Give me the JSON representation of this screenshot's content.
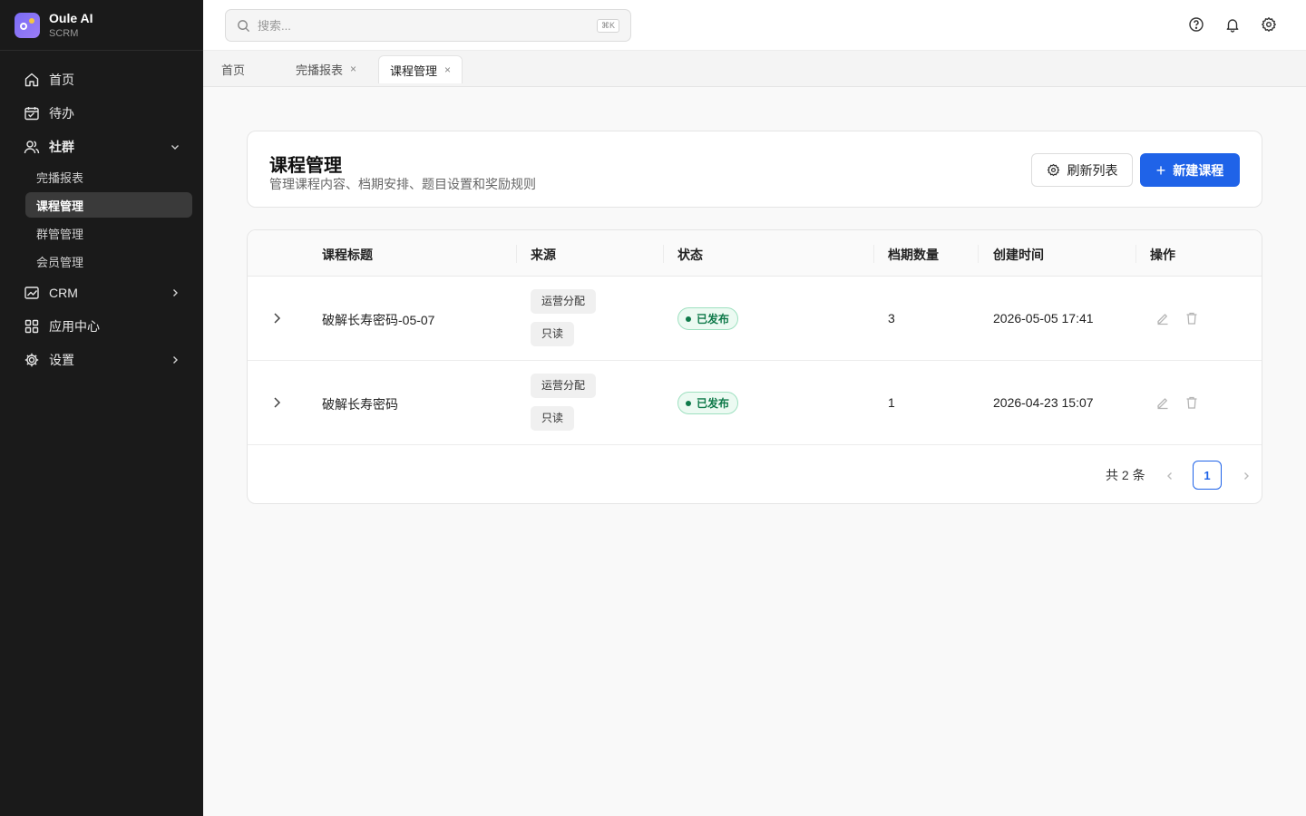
{
  "brand": {
    "name": "Oule AI",
    "subtitle": "SCRM"
  },
  "sidebar": {
    "items": [
      {
        "label": "首页",
        "icon": "home-icon"
      },
      {
        "label": "待办",
        "icon": "calendar-icon"
      },
      {
        "label": "社群",
        "icon": "users-icon",
        "expanded": true
      },
      {
        "label": "CRM",
        "icon": "chart-icon"
      },
      {
        "label": "应用中心",
        "icon": "grid-icon"
      },
      {
        "label": "设置",
        "icon": "gear-icon"
      }
    ],
    "sub_items": [
      {
        "label": "完播报表"
      },
      {
        "label": "课程管理",
        "active": true
      },
      {
        "label": "群管管理"
      },
      {
        "label": "会员管理"
      }
    ]
  },
  "search": {
    "placeholder": "搜索...",
    "shortcut": "⌘K"
  },
  "tabs": [
    {
      "label": "首页"
    },
    {
      "label": "完播报表",
      "close": "×"
    },
    {
      "label": "课程管理",
      "close": "×",
      "active": true
    }
  ],
  "page": {
    "title": "课程管理",
    "description": "管理课程内容、档期安排、题目设置和奖励规则",
    "refresh_label": "刷新列表",
    "new_label": "新建课程",
    "new_plus": "+"
  },
  "table": {
    "columns": [
      "课程标题",
      "来源",
      "状态",
      "档期数量",
      "创建时间",
      "操作"
    ],
    "rows": [
      {
        "title": "破解长寿密码-05-07",
        "tags": [
          "运营分配",
          "只读"
        ],
        "status": "已发布",
        "count": "3",
        "created": "2026-05-05 17:41"
      },
      {
        "title": "破解长寿密码",
        "tags": [
          "运营分配",
          "只读"
        ],
        "status": "已发布",
        "count": "1",
        "created": "2026-04-23 15:07"
      }
    ]
  },
  "pagination": {
    "total_text": "共 2 条",
    "current_page": "1"
  },
  "colors": {
    "accent": "#1f63e8",
    "sidebar_bg": "#1a1a1a",
    "status_green": "#0f7a4a"
  }
}
